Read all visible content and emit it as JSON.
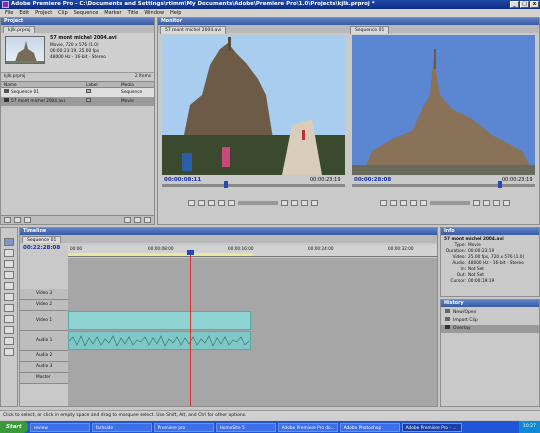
{
  "window": {
    "title": "Adobe Premiere Pro - C:\\Documents and Settings\\rtimm\\My Documents\\Adobe\\Premiere Pro\\1.0\\Projects\\kjlk.prproj *"
  },
  "menu": [
    "File",
    "Edit",
    "Project",
    "Clip",
    "Sequence",
    "Marker",
    "Title",
    "Window",
    "Help"
  ],
  "project": {
    "panel_title": "Project",
    "tab": "kjlk.prproj",
    "clip_name": "57 mont michel 2004.avi",
    "clip_info": [
      "Movie, 720 x 576 (1.0)",
      "00:00:23:19, 25.00 fps",
      "48000 Hz - 16-bit - Stereo"
    ],
    "bin_name": "kjlk.prproj",
    "items_count": "2 Items",
    "columns": [
      "Name",
      "Label",
      "Media"
    ],
    "items": [
      {
        "name": "Sequence 01",
        "media": "Sequence"
      },
      {
        "name": "57 mont michel 2004.avi",
        "media": "Movie"
      }
    ]
  },
  "monitor": {
    "panel_title": "Monitor",
    "source_tab": "57 mont michel 2004.avi",
    "program_tab": "Sequence 01",
    "source_tc": "00:00:08:11",
    "source_dur": "00:00:23:19",
    "program_tc": "00:00:28:08",
    "program_dur": "00:00:23:19"
  },
  "timeline": {
    "panel_title": "Timeline",
    "tab": "Sequence 01",
    "current_tc": "00:22:28:08",
    "ruler": [
      "00:00",
      "00:00:08:00",
      "00:00:16:00",
      "00:00:24:00",
      "00:00:32:00"
    ],
    "tracks": [
      "Video 3",
      "Video 2",
      "Video 1",
      "Audio 1",
      "Audio 2",
      "Audio 3",
      "Master"
    ]
  },
  "info": {
    "panel_title": "Info",
    "clip_name": "57 mont michel 2004.avi",
    "rows": [
      {
        "label": "Type:",
        "value": "Movie"
      },
      {
        "label": "Duration:",
        "value": "00:00:23:19"
      },
      {
        "label": "Video:",
        "value": "25.00 fps, 720 x 576 (1.0)"
      },
      {
        "label": "Audio:",
        "value": "48000 Hz - 16-bit - Stereo"
      },
      {
        "label": "In:",
        "value": "Not Set"
      },
      {
        "label": "Out:",
        "value": "Not Set"
      },
      {
        "label": "Cursor:",
        "value": "00:00:19:19"
      }
    ]
  },
  "history": {
    "panel_title": "History",
    "items": [
      "New/Open",
      "Import Clip",
      "Overlay"
    ]
  },
  "status": {
    "text": "Click to select, or click in empty space and drag to marquee select. Use Shift, Alt, and Ctrl for other options."
  },
  "taskbar": {
    "start": "Start",
    "items": [
      "review",
      "farhside",
      "Premiere pro",
      "HomeSite 5",
      "Adobe Premiere Pro do...",
      "Adobe Photoshop",
      "Adobe Premiere Pro - ..."
    ],
    "clock": "10:27"
  },
  "colors": {
    "clip_video": "#8fd4d2",
    "playhead": "#d83030",
    "timecode": "#1830a8"
  }
}
